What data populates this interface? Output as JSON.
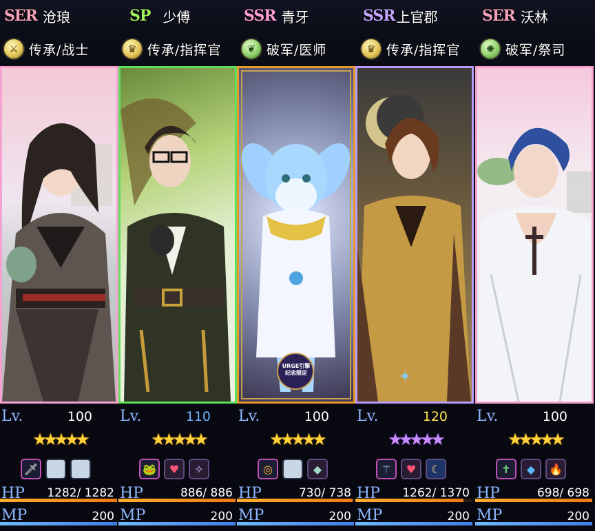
{
  "characters": [
    {
      "rarity": "SER",
      "name": "沧琅",
      "class_icon": "warrior-sword-icon",
      "class": "传承/战士",
      "level_label": "Lv.",
      "level": "100",
      "stars": 5,
      "star_color": "gold",
      "slots": [
        "item-sword",
        "empty",
        "empty"
      ],
      "hp_label": "HP",
      "hp": "1282/ 1282",
      "hp_fraction": 1.0,
      "mp_label": "MP",
      "mp": "200",
      "mp_fraction": 1.0,
      "frame_color": "#f6a2d0"
    },
    {
      "rarity": "SP",
      "name": "少傅",
      "class_icon": "commander-crown-icon",
      "class": "传承/指挥官",
      "level_label": "Lv.",
      "level": "110",
      "stars": 5,
      "star_color": "gold",
      "slots": [
        "item-frog",
        "item-heart-gem",
        "item-light"
      ],
      "hp_label": "HP",
      "hp": "886/ 886",
      "hp_fraction": 1.0,
      "mp_label": "MP",
      "mp": "200",
      "mp_fraction": 1.0,
      "frame_color": "#5fe05a"
    },
    {
      "rarity": "SSR",
      "name": "青牙",
      "class_icon": "healer-leaf-icon",
      "class": "破军/医师",
      "level_label": "Lv.",
      "level": "100",
      "stars": 5,
      "star_color": "gold",
      "slots": [
        "item-ring",
        "empty",
        "item-crystal"
      ],
      "hp_label": "HP",
      "hp": "730/ 738",
      "hp_fraction": 0.989,
      "mp_label": "MP",
      "mp": "200",
      "mp_fraction": 1.0,
      "frame_color": "#e49a2a",
      "badge_text": "URGE引擎 纪念限定"
    },
    {
      "rarity": "SSR",
      "name": "上官郡",
      "class_icon": "commander-crown-icon",
      "class": "传承/指挥官",
      "level_label": "Lv.",
      "level": "120",
      "stars": 5,
      "star_color": "purple",
      "slots": [
        "item-staff",
        "item-heart-gem",
        "item-moon"
      ],
      "hp_label": "HP",
      "hp": "1262/ 1370",
      "hp_fraction": 0.921,
      "mp_label": "MP",
      "mp": "200",
      "mp_fraction": 1.0,
      "frame_color": "#b79bff"
    },
    {
      "rarity": "SER",
      "name": "沃林",
      "class_icon": "priest-seal-icon",
      "class": "破军/祭司",
      "level_label": "Lv.",
      "level": "100",
      "stars": 5,
      "star_color": "gold",
      "slots": [
        "item-cross",
        "item-blue-gem",
        "item-flame"
      ],
      "hp_label": "HP",
      "hp": "698/ 698",
      "hp_fraction": 1.0,
      "mp_label": "MP",
      "mp": "200",
      "mp_fraction": 1.0,
      "frame_color": "#f6a2d0"
    }
  ]
}
